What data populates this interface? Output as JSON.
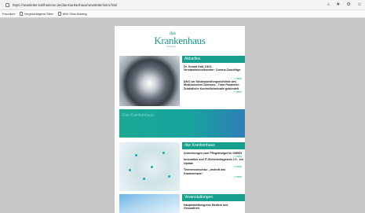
{
  "browser": {
    "url": "https://newsletter.kohlhammer.de/das-krankenhaus/newsletter/intro.html",
    "bookmarks_label": "Favoriten",
    "bookmarks": [
      "Vorgeschlagene Sites",
      "Web Slice-Katalog"
    ]
  },
  "newsletter": {
    "logo": {
      "das": "das",
      "name": "Krankenhaus",
      "sub": "Newsletter"
    },
    "section1": {
      "heading": "Aktuelles",
      "items": [
        "Dr. Gerald Gaß, DKG-Vorstandsvorsitzender: Corona-Zuschläge",
        "DKG zur Strukturprüfungsrichtlinie des Medizinischen Dienstes - Trotz Pandemie: Zusätzliche Kontrollbürokratie gebündelt"
      ],
      "mehr": [
        "» mehr",
        "» mehr"
      ]
    },
    "banner": {
      "text": "Das Krankenhaus"
    },
    "section2": {
      "heading": "das Krankenhaus",
      "items": [
        "Anmerkungen zum Pflegebudget im GMWG",
        "Innovation und IT-Sicherheitsgesetz 2.0 - ein Update",
        "Themenvorschau: „Instroft das Krankenhaus“"
      ],
      "mehr": [
        "» mehr",
        "» mehr",
        "» mehr"
      ]
    },
    "section3": {
      "heading": "Veranstaltungen",
      "items": [
        "Hauptstadtkongress Medizin und Gesundheit"
      ]
    }
  }
}
